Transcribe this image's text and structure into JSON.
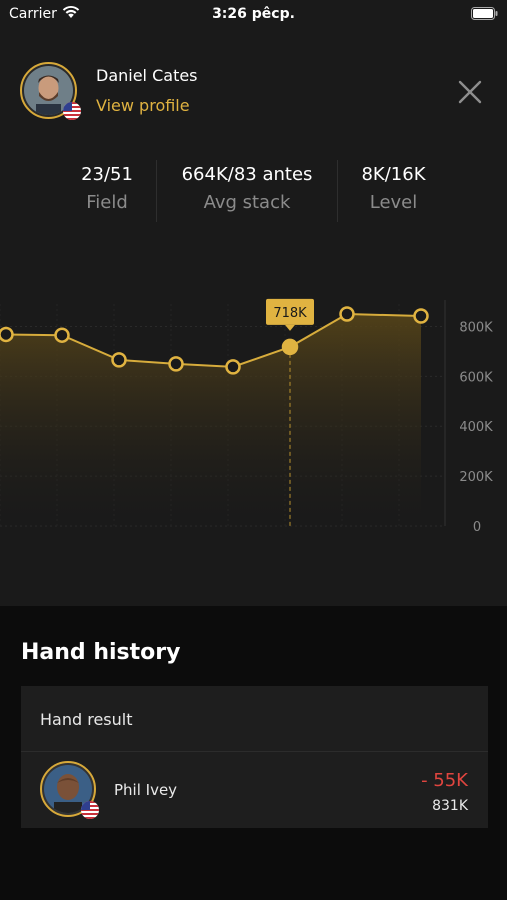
{
  "status_bar": {
    "carrier": "Carrier",
    "time": "3:26 pêcp."
  },
  "player": {
    "name": "Daniel Cates",
    "view_profile": "View profile"
  },
  "stats": [
    {
      "value": "23/51",
      "label": "Field"
    },
    {
      "value": "664K/83 antes",
      "label": "Avg stack"
    },
    {
      "value": "8K/16K",
      "label": "Level"
    }
  ],
  "colors": {
    "accent": "#e0b341",
    "negative": "#e0453f",
    "background": "#1a1a1a",
    "muted": "#8b8b8b"
  },
  "chart_data": {
    "type": "area",
    "x": [
      1,
      2,
      3,
      4,
      5,
      6,
      7,
      8
    ],
    "values": [
      768,
      765,
      666,
      650,
      638,
      718,
      850,
      842
    ],
    "unit": "K",
    "ylim": [
      0,
      850
    ],
    "y_ticks": [
      "0",
      "200K",
      "400K",
      "600K",
      "800K"
    ],
    "y_tick_values": [
      0,
      200,
      400,
      600,
      800
    ],
    "highlighted_index": 5,
    "highlighted_label": "718K",
    "axis_position": "right",
    "grid": true
  },
  "hand_history": {
    "title": "Hand history",
    "header_label": "Hand result",
    "rows": [
      {
        "player": "Phil Ivey",
        "result": "- 55K",
        "stack": "831K"
      }
    ]
  }
}
